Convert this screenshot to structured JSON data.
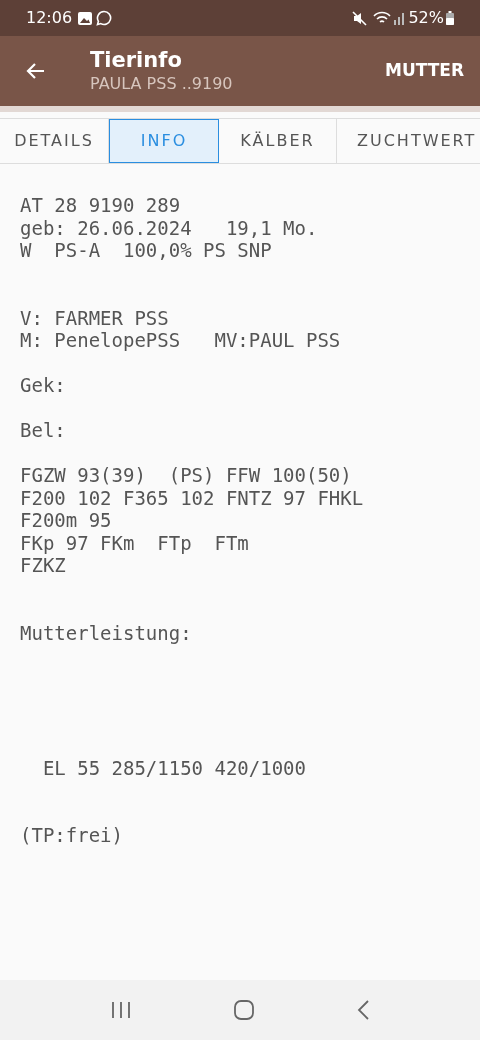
{
  "status_bar": {
    "time": "12:06",
    "battery": "52%"
  },
  "toolbar": {
    "title": "Tierinfo",
    "subtitle": "PAULA PSS ..9190",
    "action": "MUTTER"
  },
  "tabs": [
    {
      "label": "DETAILS",
      "selected": false
    },
    {
      "label": "INFO",
      "selected": true
    },
    {
      "label": "KÄLBER",
      "selected": false
    },
    {
      "label": "ZUCHTWERT",
      "selected": false
    }
  ],
  "info_text": "AT 28 9190 289\ngeb: 26.06.2024   19,1 Mo.\nW  PS-A  100,0% PS SNP\n\n\nV: FARMER PSS\nM: PenelopePSS   MV:PAUL PSS\n\nGek:\n\nBel:\n\nFGZW 93(39)  (PS) FFW 100(50)\nF200 102 F365 102 FNTZ 97 FHKL\nF200m 95\nFKp 97 FKm  FTp  FTm\nFZKZ\n\n\nMutterleistung:\n\n\n\n\n\n  EL 55 285/1150 420/1000\n\n\n(TP:frei)"
}
